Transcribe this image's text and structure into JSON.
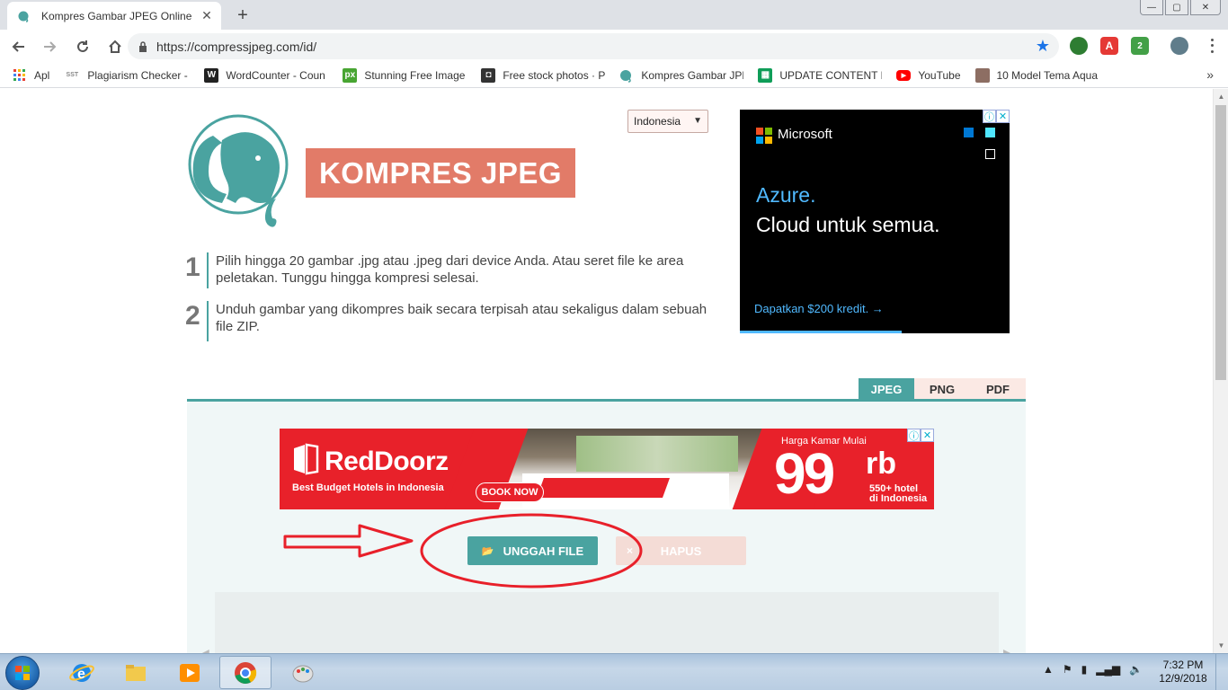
{
  "browser": {
    "tab_title": "Kompres Gambar JPEG Online",
    "tab_close": "✕",
    "new_tab": "+",
    "url": "https://compressjpeg.com/id/",
    "window_controls": [
      "—",
      "▢",
      "✕"
    ],
    "extensions": [
      {
        "name": "globe-extension-icon",
        "label": "",
        "color": "#2e7d32"
      },
      {
        "name": "acrobat-extension-icon",
        "label": "A",
        "color": "#e53935"
      },
      {
        "name": "grammar-extension-icon",
        "label": "2",
        "color": "#43a047"
      },
      {
        "name": "profile-avatar-icon",
        "label": "",
        "color": "#607d8b"
      }
    ],
    "bookmarks": [
      {
        "name": "apps",
        "label": "Apl",
        "icon": "apps-grid-icon",
        "color": "#e94235"
      },
      {
        "name": "plagiarism-checker",
        "label": "Plagiarism Checker -",
        "icon": "sst-icon",
        "color": "#999999",
        "glyph": "SST"
      },
      {
        "name": "wordcounter",
        "label": "WordCounter - Coun",
        "icon": "wordcounter-icon",
        "color": "#222222",
        "glyph": "W"
      },
      {
        "name": "stunning-free-image",
        "label": "Stunning Free Image",
        "icon": "pixabay-icon",
        "color": "#48a532",
        "glyph": "px"
      },
      {
        "name": "free-stock-photos",
        "label": "Free stock photos · P",
        "icon": "camera-icon",
        "color": "#333333",
        "glyph": "◘"
      },
      {
        "name": "kompres-gambar",
        "label": "Kompres Gambar JPE",
        "icon": "elephant-icon",
        "color": "#4aa3a0",
        "glyph": ""
      },
      {
        "name": "update-content",
        "label": "UPDATE CONTENT P",
        "icon": "sheets-icon",
        "color": "#0f9d58",
        "glyph": "▦"
      },
      {
        "name": "youtube",
        "label": "YouTube",
        "icon": "youtube-icon",
        "color": "#ff0000",
        "glyph": "▶"
      },
      {
        "name": "model-tema-aqua",
        "label": "10 Model Tema Aqua",
        "icon": "thumbnail-icon",
        "color": "#8d6e63",
        "glyph": ""
      }
    ],
    "bookmarks_more": "»"
  },
  "page": {
    "brand": "KOMPRES JPEG",
    "language": "Indonesia",
    "steps": [
      {
        "num": "1",
        "text": "Pilih hingga 20 gambar .jpg atau .jpeg dari device Anda. Atau seret file ke area peletakan. Tunggu hingga kompresi selesai."
      },
      {
        "num": "2",
        "text": "Unduh gambar yang dikompres baik secara terpisah atau sekaligus dalam sebuah file ZIP."
      }
    ],
    "tabs": [
      {
        "label": "JPEG",
        "active": true
      },
      {
        "label": "PNG",
        "active": false
      },
      {
        "label": "PDF",
        "active": false
      }
    ],
    "upload_label": "UNGGAH FILE",
    "delete_label": "HAPUS",
    "delete_icon": "×",
    "colors": {
      "accent": "#4aa3a0",
      "brand": "#e27b68",
      "annotation": "#e8202a"
    }
  },
  "ads": {
    "microsoft": {
      "brand": "Microsoft",
      "headline_1": "Azure.",
      "headline_2": "Cloud untuk semua.",
      "cta": "Dapatkan $200 kredit. →"
    },
    "reddoorz": {
      "brand": "RedDoorz",
      "tagline": "Best Budget Hotels in Indonesia",
      "cta": "BOOK NOW",
      "price_caption": "Harga Kamar Mulai",
      "price": "99",
      "price_unit": "rb",
      "hotels_line1": "550+ hotel",
      "hotels_line2": "di Indonesia"
    },
    "adchoice_info": "ⓘ",
    "adchoice_close": "✕"
  },
  "taskbar": {
    "time": "7:32 PM",
    "date": "12/9/2018"
  }
}
